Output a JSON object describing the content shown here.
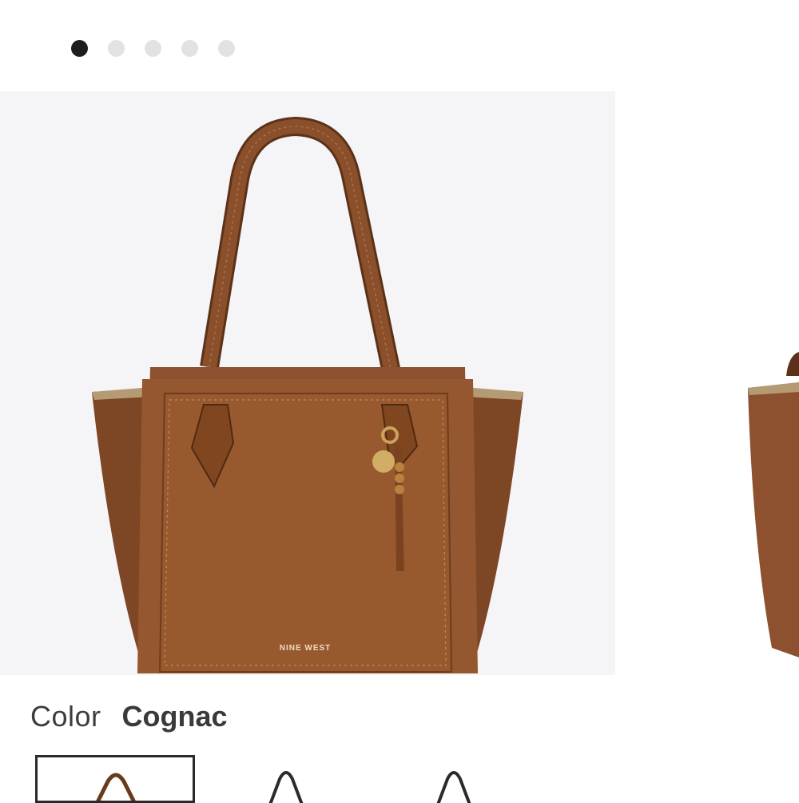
{
  "carousel": {
    "total_slides": 5,
    "active_slide": 1,
    "dots": [
      {
        "state": "active"
      },
      {
        "state": "inactive"
      },
      {
        "state": "inactive"
      },
      {
        "state": "inactive"
      },
      {
        "state": "inactive"
      }
    ]
  },
  "product": {
    "brand_mark": "NINE WEST",
    "color_label": "Color",
    "color_value": "Cognac"
  },
  "swatches": [
    {
      "name": "Cognac",
      "selected": true
    },
    {
      "name": "",
      "selected": false
    },
    {
      "name": "",
      "selected": false
    }
  ],
  "colors": {
    "active_dot": "#1e1e1e",
    "inactive_dot": "#e2e2e4",
    "bag_leather": "#8a4f2b",
    "image_background": "#f5f5f7",
    "hardware_gold": "#caa25a"
  }
}
